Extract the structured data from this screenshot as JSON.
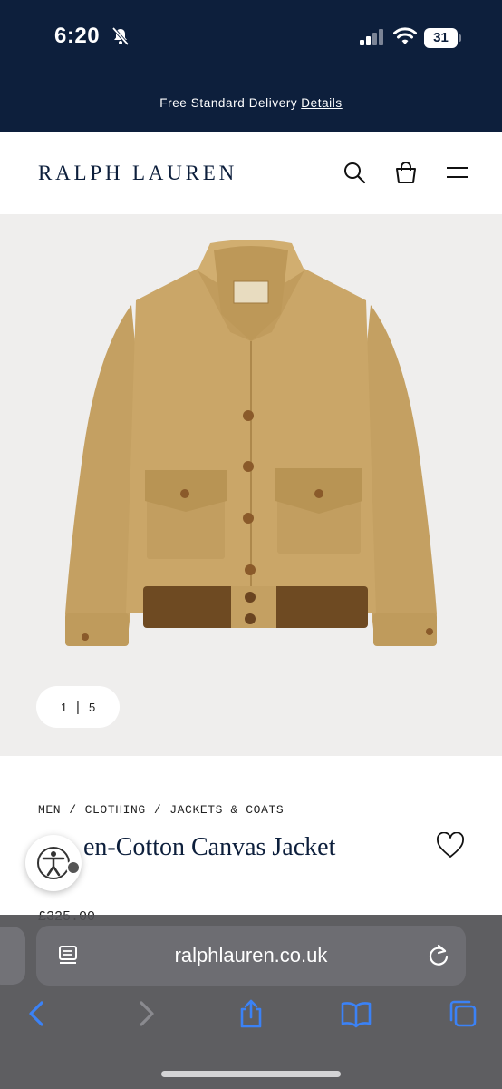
{
  "status": {
    "time": "6:20",
    "battery": "31",
    "icons": [
      "bell-off-icon",
      "cellular-signal-icon",
      "wifi-icon",
      "battery-icon"
    ]
  },
  "promo": {
    "text": "Free Standard Delivery",
    "link": "Details"
  },
  "header": {
    "logo": "RALPH LAUREN",
    "icons": [
      "search-icon",
      "shopping-bag-icon",
      "hamburger-menu-icon"
    ]
  },
  "gallery": {
    "current": "1",
    "separator": "|",
    "total": "5"
  },
  "product": {
    "breadcrumb": [
      "MEN",
      "CLOTHING",
      "JACKETS & COATS"
    ],
    "breadcrumb_sep": "/",
    "title": "en-Cotton Canvas Jacket",
    "price_partial": "£325.00"
  },
  "browser": {
    "url": "ralphlauren.co.uk",
    "icons": [
      "reader-icon",
      "reload-icon",
      "back-icon",
      "forward-icon",
      "share-icon",
      "bookmarks-icon",
      "tabs-icon"
    ]
  },
  "colors": {
    "navy": "#0d1f3c",
    "image_bg": "#efeeed",
    "jacket": "#c9a466",
    "rib_knit": "#6e4a22",
    "safari_accent": "#3b82f6"
  }
}
